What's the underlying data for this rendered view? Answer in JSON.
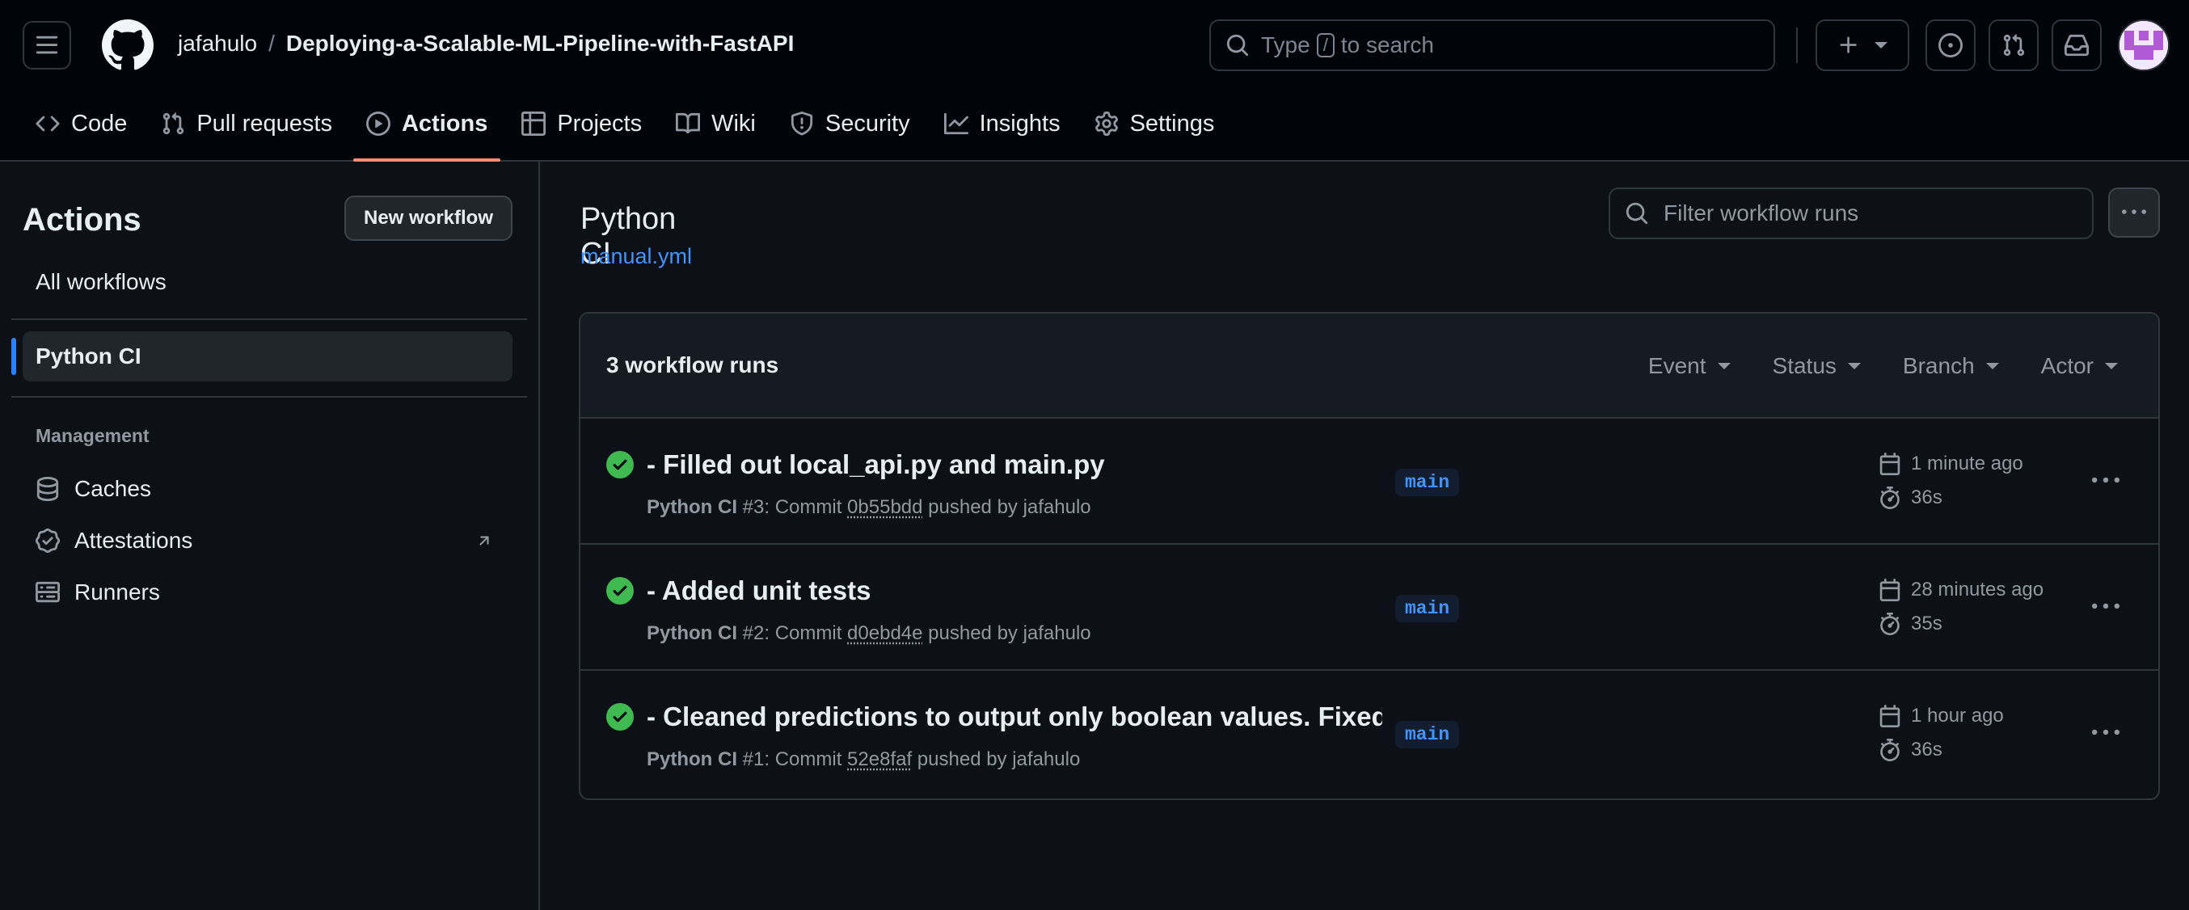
{
  "header": {
    "owner": "jafahulo",
    "separator": "/",
    "repo": "Deploying-a-Scalable-ML-Pipeline-with-FastAPI",
    "search_prefix": "Type",
    "search_key": "/",
    "search_suffix": "to search"
  },
  "tabs": [
    {
      "label": "Code",
      "icon": "code-icon"
    },
    {
      "label": "Pull requests",
      "icon": "git-pull-request-icon"
    },
    {
      "label": "Actions",
      "icon": "play-icon",
      "active": true
    },
    {
      "label": "Projects",
      "icon": "table-icon"
    },
    {
      "label": "Wiki",
      "icon": "book-icon"
    },
    {
      "label": "Security",
      "icon": "shield-icon"
    },
    {
      "label": "Insights",
      "icon": "graph-icon"
    },
    {
      "label": "Settings",
      "icon": "gear-icon"
    }
  ],
  "sidebar": {
    "title": "Actions",
    "new_workflow": "New workflow",
    "all_workflows": "All workflows",
    "active_workflow": "Python CI",
    "section": "Management",
    "items": [
      {
        "label": "Caches",
        "icon": "database-icon"
      },
      {
        "label": "Attestations",
        "icon": "verified-icon"
      },
      {
        "label": "Runners",
        "icon": "server-icon"
      }
    ]
  },
  "main": {
    "title": "Python CI",
    "file": "manual.yml",
    "filter_placeholder": "Filter workflow runs",
    "runs_count": "3 workflow runs",
    "filters": [
      "Event",
      "Status",
      "Branch",
      "Actor"
    ]
  },
  "runs": [
    {
      "title": "- Filled out local_api.py and main.py",
      "workflow": "Python CI",
      "number": "#3: Commit",
      "sha": "0b55bdd",
      "pushed": "pushed by jafahulo",
      "branch": "main",
      "time": "1 minute ago",
      "duration": "36s",
      "status": "success"
    },
    {
      "title": "- Added unit tests",
      "workflow": "Python CI",
      "number": "#2: Commit",
      "sha": "d0ebd4e",
      "pushed": "pushed by jafahulo",
      "branch": "main",
      "time": "28 minutes ago",
      "duration": "35s",
      "status": "success"
    },
    {
      "title": "- Cleaned predictions to output only boolean values. Fixed...",
      "workflow": "Python CI",
      "number": "#1: Commit",
      "sha": "52e8faf",
      "pushed": "pushed by jafahulo",
      "branch": "main",
      "time": "1 hour ago",
      "duration": "36s",
      "status": "success"
    }
  ],
  "colors": {
    "accent": "#2f81f7",
    "tab_underline": "#fd8c73",
    "success": "#3fb950",
    "link": "#4493f8"
  }
}
